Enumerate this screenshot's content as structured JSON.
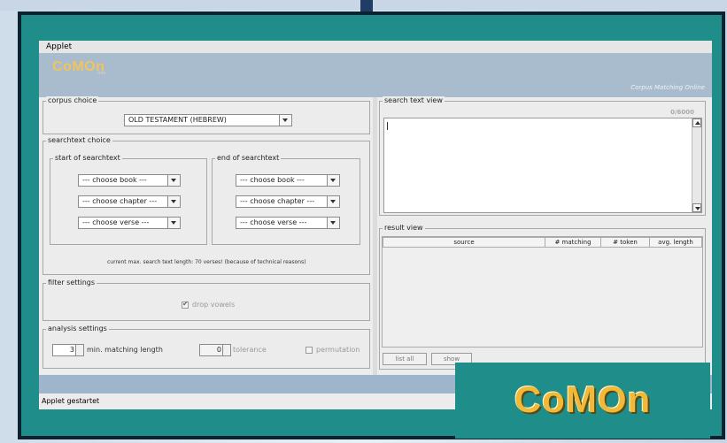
{
  "menu": {
    "applet": "Applet"
  },
  "banner": {
    "logo": "CoMOn",
    "logo_sub": "info",
    "tagline": "Corpus Matching Online"
  },
  "corpus_choice": {
    "legend": "corpus choice",
    "selected": "OLD TESTAMENT (HEBREW)"
  },
  "searchtext_choice": {
    "legend": "searchtext choice",
    "start": {
      "legend": "start of searchtext",
      "book": "--- choose book ---",
      "chapter": "--- choose chapter ---",
      "verse": "--- choose verse ---"
    },
    "end": {
      "legend": "end of searchtext",
      "book": "--- choose book ---",
      "chapter": "--- choose chapter ---",
      "verse": "--- choose verse ---"
    },
    "note": "current max. search text length: 70 verses! (because of technical reasons)"
  },
  "filter_settings": {
    "legend": "filter settings",
    "drop_vowels": "drop vowels"
  },
  "analysis_settings": {
    "legend": "analysis settings",
    "min_value": "3",
    "min_label": "min. matching length",
    "tol_value": "0",
    "tol_label": "tolerance",
    "permutation": "permutation"
  },
  "search_text_view": {
    "legend": "search text view",
    "counter": "0/6000"
  },
  "result_view": {
    "legend": "result view",
    "columns": [
      "source",
      "# matching",
      "# token",
      "avg. length"
    ],
    "list_all": "list all",
    "show": "show"
  },
  "status": "Applet gestartet",
  "overlay_logo": "CoMOn"
}
